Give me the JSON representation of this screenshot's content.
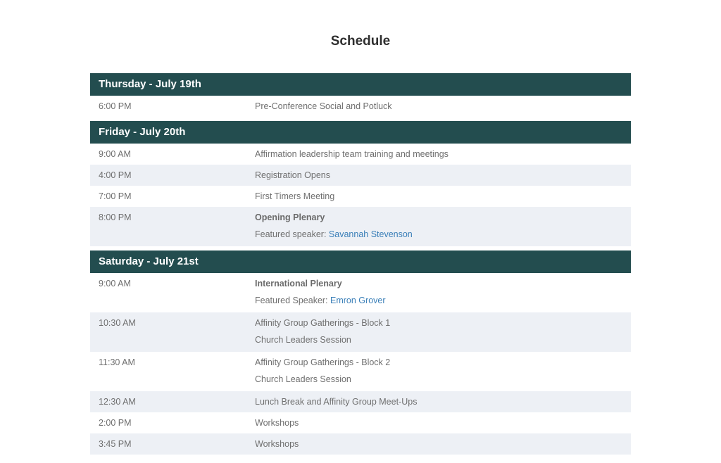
{
  "page": {
    "title": "Schedule"
  },
  "days": [
    {
      "header": "Thursday - July 19th",
      "events": [
        {
          "time": "6:00 PM",
          "title": "Pre-Conference Social and Potluck"
        }
      ]
    },
    {
      "header": "Friday - July 20th",
      "events": [
        {
          "time": "9:00 AM",
          "title": "Affirmation leadership team training and meetings"
        },
        {
          "time": "4:00 PM",
          "title": "Registration Opens"
        },
        {
          "time": "7:00 PM",
          "title": "First Timers Meeting"
        },
        {
          "time": "8:00 PM",
          "title": "Opening Plenary",
          "speaker_prefix": "Featured speaker: ",
          "speaker_name": "Savannah Stevenson"
        }
      ]
    },
    {
      "header": "Saturday - July 21st",
      "events": [
        {
          "time": "9:00 AM",
          "title": "International Plenary",
          "speaker_prefix": "Featured Speaker: ",
          "speaker_name": "Emron Grover"
        },
        {
          "time": "10:30 AM",
          "title": "Affinity Group Gatherings - Block 1",
          "subtitle": "Church Leaders Session"
        },
        {
          "time": "11:30 AM",
          "title": "Affinity Group Gatherings - Block 2",
          "subtitle": "Church Leaders Session"
        },
        {
          "time": "12:30 AM",
          "title": "Lunch Break and Affinity Group Meet-Ups"
        },
        {
          "time": "2:00 PM",
          "title": "Workshops"
        },
        {
          "time": "3:45 PM",
          "title": "Workshops"
        }
      ]
    }
  ]
}
